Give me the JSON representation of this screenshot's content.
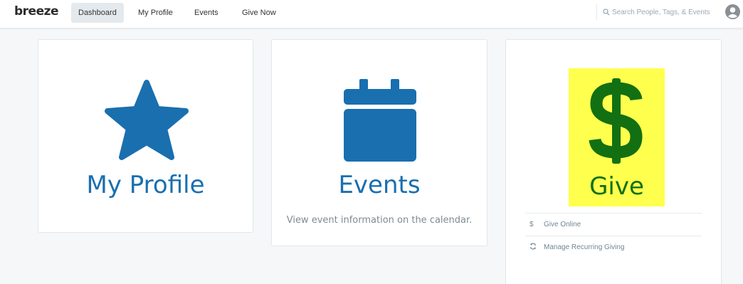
{
  "header": {
    "logo": "breeze",
    "nav": [
      {
        "label": "Dashboard",
        "active": true
      },
      {
        "label": "My Profile",
        "active": false
      },
      {
        "label": "Events",
        "active": false
      },
      {
        "label": "Give Now",
        "active": false
      }
    ],
    "search_placeholder": "Search People, Tags, & Events"
  },
  "cards": {
    "profile": {
      "title": "My Profile",
      "icon": "star-icon"
    },
    "events": {
      "title": "Events",
      "description": "View event information on the calendar.",
      "icon": "calendar-icon"
    },
    "give": {
      "title": "Give",
      "icon": "dollar-icon",
      "links": [
        {
          "icon": "$",
          "label": "Give Online"
        },
        {
          "icon": "refresh-icon",
          "label": "Manage Recurring Giving"
        }
      ]
    }
  },
  "colors": {
    "brand_blue": "#1a6faf",
    "give_green": "#127012",
    "highlight_yellow": "#ffff4d"
  }
}
